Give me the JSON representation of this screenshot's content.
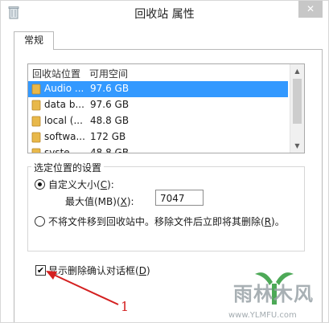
{
  "window": {
    "title": "回收站 属性",
    "close_glyph": "✕"
  },
  "tabs": [
    {
      "label": "常规",
      "active": true
    }
  ],
  "list": {
    "columns": [
      "回收站位置",
      "可用空间"
    ],
    "rows": [
      {
        "name": "Audio ...",
        "space": "97.6 GB",
        "selected": true
      },
      {
        "name": "data b...",
        "space": "97.6 GB",
        "selected": false
      },
      {
        "name": "local (...",
        "space": "48.8 GB",
        "selected": false
      },
      {
        "name": "softwa...",
        "space": "172 GB",
        "selected": false
      },
      {
        "name": "syste...",
        "space": "48.8 GB",
        "selected": false
      }
    ]
  },
  "settings": {
    "group_title": "选定位置的设置",
    "custom_size": {
      "label": "自定义大小(",
      "accel": "C",
      "label_end": "):",
      "checked": true
    },
    "max_size": {
      "label": "最大值(MB)(",
      "accel": "X",
      "label_end": "):",
      "value": "7047"
    },
    "no_recycle": {
      "label": "不将文件移到回收站中。移除文件后立即将其删除(",
      "accel": "R",
      "label_end": ")。",
      "checked": false
    }
  },
  "confirm_dialog": {
    "label": "显示删除确认对话框(",
    "accel": "D",
    "label_end": ")",
    "checked": true,
    "check_glyph": "✔"
  },
  "annotation": {
    "number": "1",
    "color": "#d42020"
  },
  "watermark": {
    "main": "雨林木风",
    "url": "www.YLMFU.com"
  },
  "colors": {
    "selection": "#3399ff",
    "folder": "#e8b84a"
  }
}
